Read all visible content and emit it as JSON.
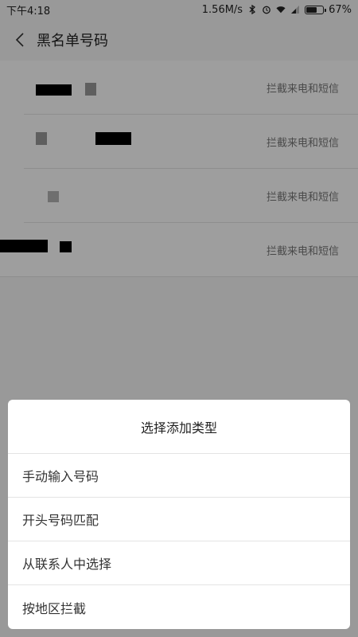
{
  "statusbar": {
    "time": "下午4:18",
    "speed": "1.56M/s",
    "battery_percent_text": "67%",
    "battery_level": 0.67
  },
  "header": {
    "title": "黑名单号码"
  },
  "blacklist": {
    "items": [
      {
        "label": "拦截来电和短信"
      },
      {
        "label": "拦截来电和短信"
      },
      {
        "label": "拦截来电和短信"
      },
      {
        "label": "拦截来电和短信"
      }
    ]
  },
  "dialog": {
    "title": "选择添加类型",
    "options": [
      {
        "label": "手动输入号码"
      },
      {
        "label": "开头号码匹配"
      },
      {
        "label": "从联系人中选择"
      },
      {
        "label": "按地区拦截"
      }
    ]
  },
  "icons": {
    "back": "chevron-left-icon",
    "bluetooth": "bluetooth-icon",
    "alarm": "alarm-icon",
    "wifi": "wifi-icon",
    "signal": "signal-icon",
    "battery": "battery-icon"
  }
}
